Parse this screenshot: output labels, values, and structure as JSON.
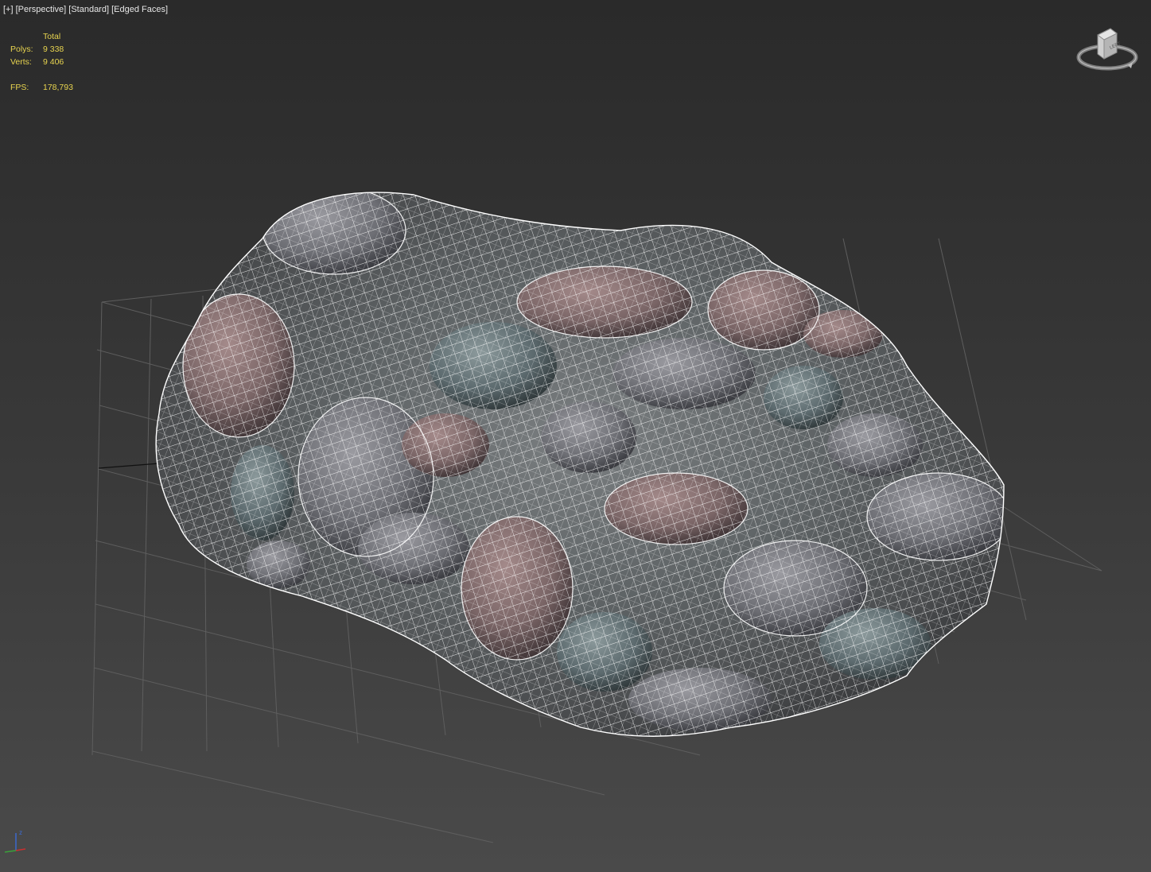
{
  "viewport": {
    "labels": {
      "menu": "[+]",
      "view": "[Perspective]",
      "shading": "[Standard]",
      "mode": "[Edged Faces]"
    },
    "stats": {
      "header": "Total",
      "polys_label": "Polys:",
      "polys_value": "9 338",
      "verts_label": "Verts:",
      "verts_value": "9 406",
      "fps_label": "FPS:",
      "fps_value": "178,793"
    },
    "viewcube": {
      "face_label": "LEFT"
    },
    "axis": {
      "z_label": "z"
    }
  },
  "colors": {
    "background_top": "#2a2a2a",
    "background_bottom": "#4a4a4a",
    "grid_line": "#5e5e5e",
    "stats_text": "#e8d44f",
    "label_text": "#e6e6e6",
    "wire": "#ffffff",
    "rock_base": "#5d6266"
  },
  "icons": [
    "viewcube-icon",
    "axis-tripod-icon"
  ]
}
